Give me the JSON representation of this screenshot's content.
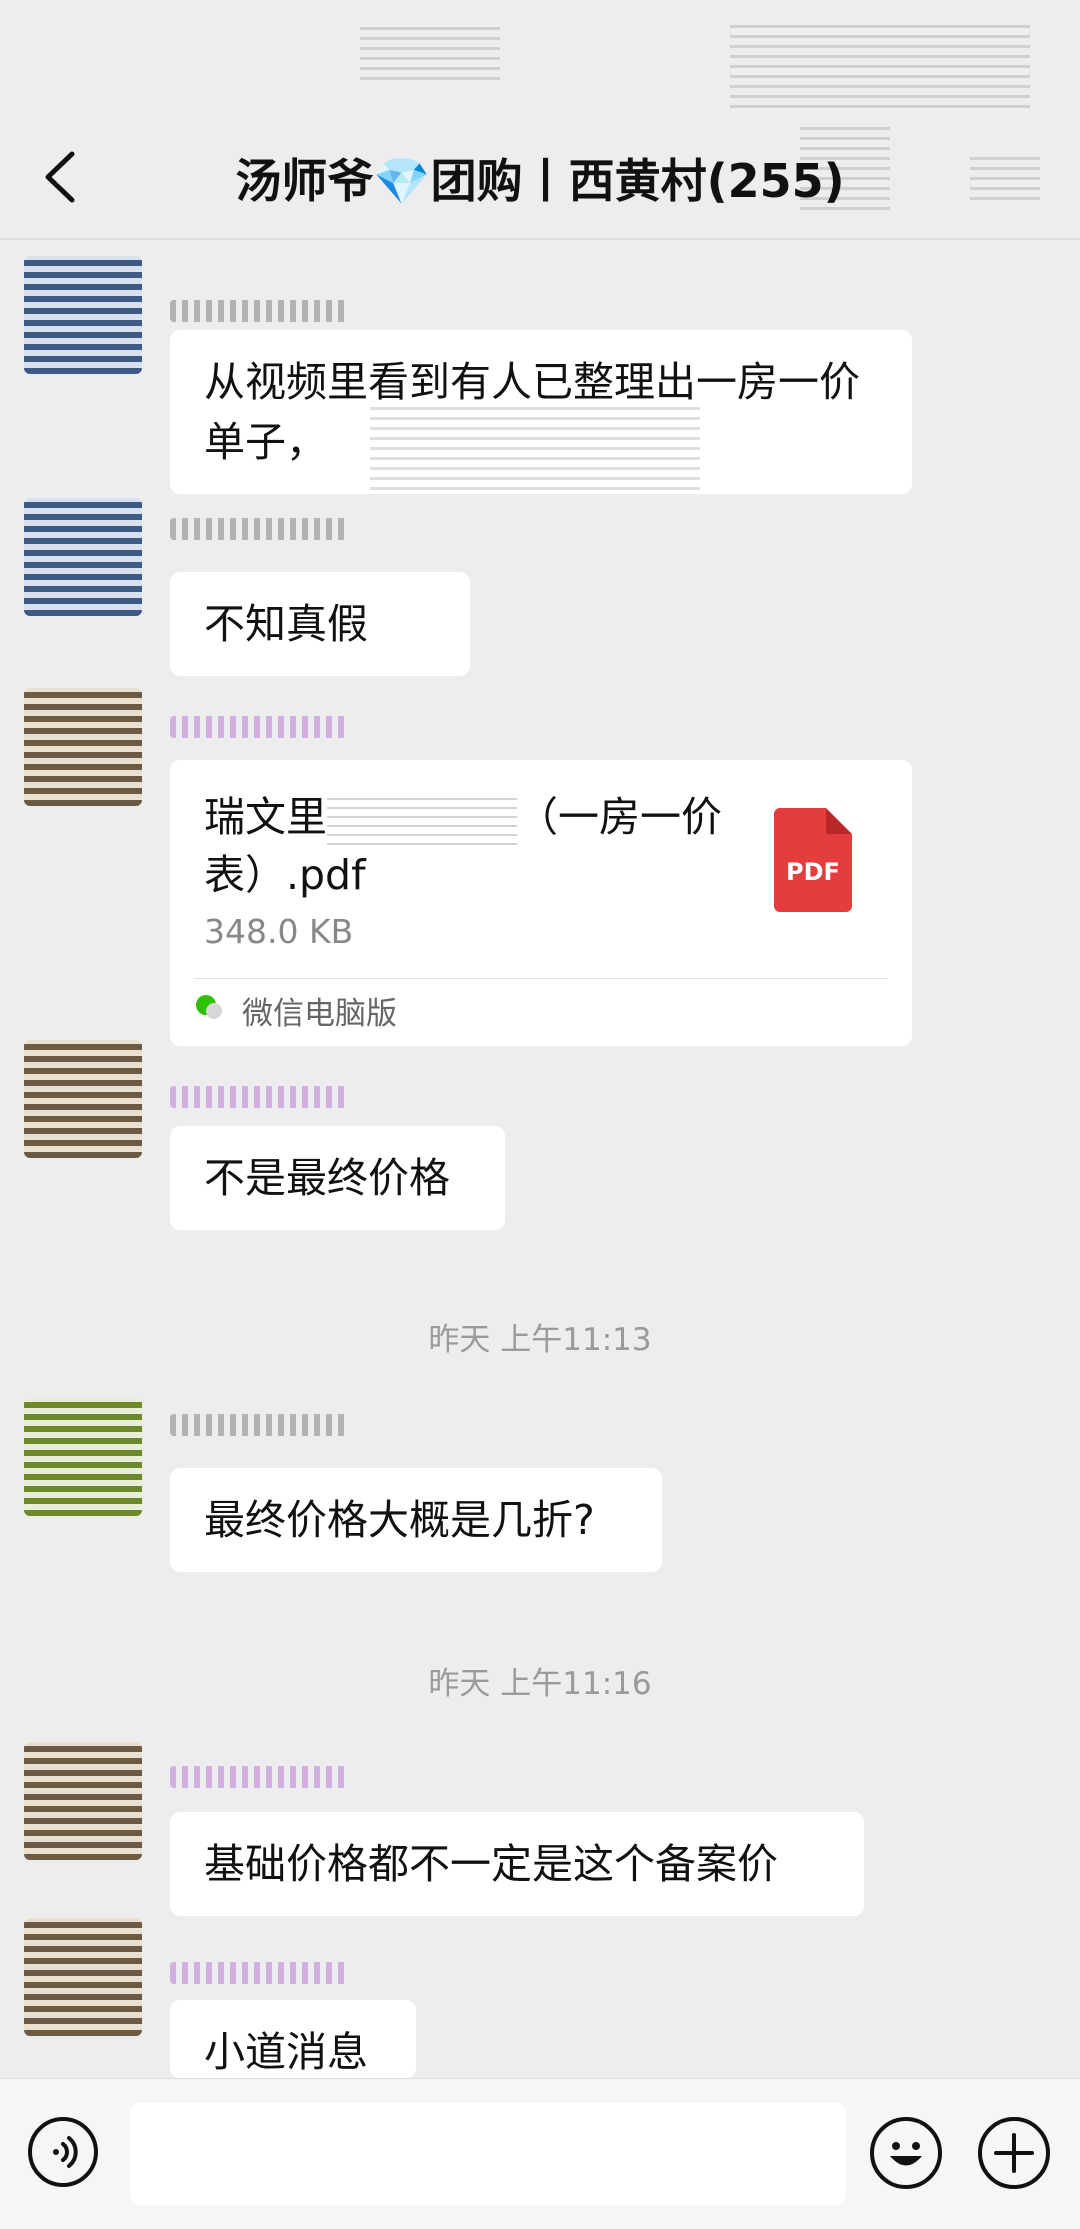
{
  "header": {
    "title_prefix": "汤师爷",
    "gem": "💎",
    "title_suffix": "团购丨西黄村(255)"
  },
  "messages": [
    {
      "text": "从视频里看到有人已整理出一房一价单子，"
    },
    {
      "text": "不知真假"
    },
    {
      "file": {
        "name_start": "瑞文里",
        "name_end": "（一房一价表）.pdf",
        "size": "348.0 KB",
        "icon_label": "PDF",
        "source": "微信电脑版"
      }
    },
    {
      "text": "不是最终价格"
    },
    {
      "time": "昨天 上午11:13"
    },
    {
      "text": "最终价格大概是几折?"
    },
    {
      "time": "昨天 上午11:16"
    },
    {
      "text": "基础价格都不一定是这个备案价"
    },
    {
      "text": "小道消息"
    }
  ],
  "colors": {
    "background": "#ededed",
    "bubble": "#ffffff",
    "pdf": "#e43d3d",
    "accent": "#39a9f2"
  },
  "icons": [
    "back-icon",
    "voice-icon",
    "emoji-icon",
    "plus-icon",
    "pdf-icon",
    "wechat-icon"
  ]
}
